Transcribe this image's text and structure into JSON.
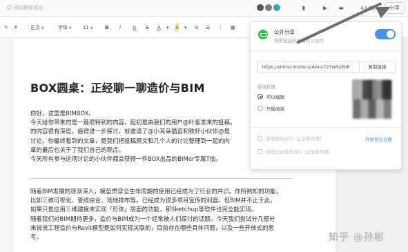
{
  "header": {
    "autosave": "自动保存成功",
    "collab": "4人协作",
    "share": "分享"
  },
  "toolbar": {
    "paragraph": "正文",
    "font": "字体",
    "size": "11",
    "bold": "B",
    "italic": "I",
    "underline": "U",
    "strike": "S",
    "font_color": "A",
    "highlight": "A"
  },
  "document": {
    "title": "BOX圆桌：正经聊一聊造价与BIM",
    "paragraph1": [
      "你好，这里是BIMBOX。",
      "今天给你带来的是一篇很特别的内容，起初是由我们的用户@叶鉴发来的投稿，",
      "的内容很有深度，值得进一步探讨，就邀请了@小耳朵猫苗和铁杆小伙伴@是",
      "讨论，你最终看到的文章，是我们把投稿原文和几个人的讨论整理到一起的内",
      "章的最后也关于了我们自己的观点。",
      "今天所有参与这场讨论的小伙伴都会获得一件BOX出品的BIMer专属T恤。"
    ],
    "paragraph2": [
      "随着BIM发展的逐渐深入，模型贯穿全生命周期的使用已经成为了行业的共识。你所熟知的功能，",
      "比如三维可视化、管线综合、场地排布等，已经成为很多项目宣传的利器。但BIM并不止于此，",
      "如果只是应用三维建模来实现「形体」层面的功能，那Sketchup等软件也完全能实现。",
      "随着我们对BIM期待更多，造价与BIM成为一个经常被人们探讨的话题。今天我们尝试分几部分",
      "来说说工程造价与Revit模型是如何实现关联的，目前存在哪些具体问题，以及一些开放式的思",
      "考。"
    ]
  },
  "share_panel": {
    "title": "公开分享",
    "desc": "获得链接的人都可以访问",
    "url": "https://shimo.im/docs/AAnz727wR2EbE",
    "copy": "复制链接",
    "permission_label": "链接权限",
    "options": [
      "可以编辑",
      "只能阅读"
    ],
    "selected_option": "可以编辑",
    "check1": "需要密码访问（企业版可用）",
    "check2": "仅限企业成员访问（企业版可用）",
    "upgrade": "升级到企业版"
  },
  "watermark": "知乎 @孙彬",
  "colors": {
    "accent": "#4a90e2",
    "green": "#3cb54a",
    "arrow": "#6d6d6d"
  }
}
